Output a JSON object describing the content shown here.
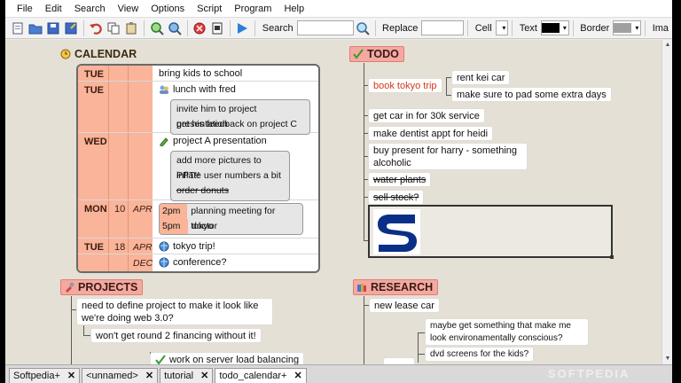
{
  "menu": [
    "File",
    "Edit",
    "Search",
    "View",
    "Options",
    "Script",
    "Program",
    "Help"
  ],
  "toolbar": {
    "search_label": "Search",
    "search_value": "",
    "replace_label": "Replace",
    "replace_value": "",
    "cell_label": "Cell",
    "text_label": "Text",
    "text_color": "#000000",
    "border_label": "Border",
    "border_color": "#a0a0a0",
    "overflow_label": "Ima"
  },
  "calendar": {
    "title": "CALENDAR",
    "rows": [
      {
        "day": "TUE",
        "num": "",
        "mon": "",
        "text": "bring kids to school",
        "icon": ""
      },
      {
        "day": "TUE",
        "num": "",
        "mon": "",
        "text": "lunch with fred",
        "icon": "people-icon",
        "sub": [
          "invite him to project presentation",
          "get his feedback on project C"
        ]
      },
      {
        "day": "WED",
        "num": "",
        "mon": "",
        "text": "project A presentation",
        "icon": "pencil-icon",
        "sub": [
          "add more pictures to PPT!!",
          "inflate user numbers a bit",
          "order donuts"
        ]
      },
      {
        "day": "MON",
        "num": "10",
        "mon": "APR",
        "times": [
          {
            "time": "2pm",
            "text": "planning meeting for tokyo"
          },
          {
            "time": "5pm",
            "text": "doctor"
          }
        ]
      },
      {
        "day": "TUE",
        "num": "18",
        "mon": "APR",
        "text": "tokyo trip!",
        "icon": "globe-icon"
      },
      {
        "day": "",
        "num": "",
        "mon": "DEC",
        "text": "conference?",
        "icon": "globe-icon"
      }
    ]
  },
  "todo": {
    "title": "TODO",
    "items": {
      "tokyo": "book tokyo trip",
      "car": "rent kei car",
      "pad": "make sure to pad some extra days",
      "service": "get car in for 30k service",
      "dentist": "make dentist appt for heidi",
      "present": "buy present for harry - something alcoholic",
      "water": "water plants",
      "stock": "sell stock?"
    }
  },
  "projects": {
    "title": "PROJECTS",
    "items": {
      "define": "need to define project to make it look like we're doing web 3.0?",
      "financing": "won't get round 2 financing without it!",
      "load": "work on server load balancing"
    }
  },
  "research": {
    "title": "RESEARCH",
    "items": {
      "lease": "new lease car",
      "enviro": "maybe get something that make me look environamentally conscious?",
      "dvd": "dvd screens for the kids?"
    }
  },
  "tabs": [
    {
      "label": "Softpedia+",
      "active": false
    },
    {
      "label": "<unnamed>",
      "active": false
    },
    {
      "label": "tutorial",
      "active": false
    },
    {
      "label": "todo_calendar+",
      "active": true
    }
  ],
  "watermark": "SOFTPEDIA",
  "colors": {
    "accent": "#f4a9a0",
    "day_cell": "#f9b49a",
    "done_red": "#d13a1a"
  }
}
